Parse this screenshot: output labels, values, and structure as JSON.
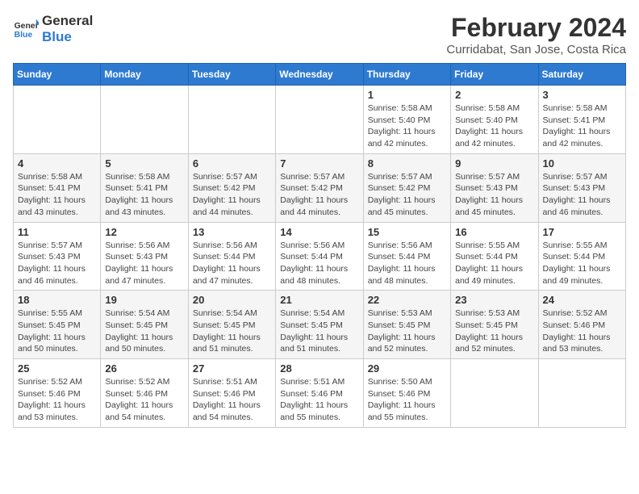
{
  "logo": {
    "line1": "General",
    "line2": "Blue"
  },
  "title": "February 2024",
  "location": "Curridabat, San Jose, Costa Rica",
  "weekdays": [
    "Sunday",
    "Monday",
    "Tuesday",
    "Wednesday",
    "Thursday",
    "Friday",
    "Saturday"
  ],
  "weeks": [
    [
      {
        "day": "",
        "info": ""
      },
      {
        "day": "",
        "info": ""
      },
      {
        "day": "",
        "info": ""
      },
      {
        "day": "",
        "info": ""
      },
      {
        "day": "1",
        "info": "Sunrise: 5:58 AM\nSunset: 5:40 PM\nDaylight: 11 hours\nand 42 minutes."
      },
      {
        "day": "2",
        "info": "Sunrise: 5:58 AM\nSunset: 5:40 PM\nDaylight: 11 hours\nand 42 minutes."
      },
      {
        "day": "3",
        "info": "Sunrise: 5:58 AM\nSunset: 5:41 PM\nDaylight: 11 hours\nand 42 minutes."
      }
    ],
    [
      {
        "day": "4",
        "info": "Sunrise: 5:58 AM\nSunset: 5:41 PM\nDaylight: 11 hours\nand 43 minutes."
      },
      {
        "day": "5",
        "info": "Sunrise: 5:58 AM\nSunset: 5:41 PM\nDaylight: 11 hours\nand 43 minutes."
      },
      {
        "day": "6",
        "info": "Sunrise: 5:57 AM\nSunset: 5:42 PM\nDaylight: 11 hours\nand 44 minutes."
      },
      {
        "day": "7",
        "info": "Sunrise: 5:57 AM\nSunset: 5:42 PM\nDaylight: 11 hours\nand 44 minutes."
      },
      {
        "day": "8",
        "info": "Sunrise: 5:57 AM\nSunset: 5:42 PM\nDaylight: 11 hours\nand 45 minutes."
      },
      {
        "day": "9",
        "info": "Sunrise: 5:57 AM\nSunset: 5:43 PM\nDaylight: 11 hours\nand 45 minutes."
      },
      {
        "day": "10",
        "info": "Sunrise: 5:57 AM\nSunset: 5:43 PM\nDaylight: 11 hours\nand 46 minutes."
      }
    ],
    [
      {
        "day": "11",
        "info": "Sunrise: 5:57 AM\nSunset: 5:43 PM\nDaylight: 11 hours\nand 46 minutes."
      },
      {
        "day": "12",
        "info": "Sunrise: 5:56 AM\nSunset: 5:43 PM\nDaylight: 11 hours\nand 47 minutes."
      },
      {
        "day": "13",
        "info": "Sunrise: 5:56 AM\nSunset: 5:44 PM\nDaylight: 11 hours\nand 47 minutes."
      },
      {
        "day": "14",
        "info": "Sunrise: 5:56 AM\nSunset: 5:44 PM\nDaylight: 11 hours\nand 48 minutes."
      },
      {
        "day": "15",
        "info": "Sunrise: 5:56 AM\nSunset: 5:44 PM\nDaylight: 11 hours\nand 48 minutes."
      },
      {
        "day": "16",
        "info": "Sunrise: 5:55 AM\nSunset: 5:44 PM\nDaylight: 11 hours\nand 49 minutes."
      },
      {
        "day": "17",
        "info": "Sunrise: 5:55 AM\nSunset: 5:44 PM\nDaylight: 11 hours\nand 49 minutes."
      }
    ],
    [
      {
        "day": "18",
        "info": "Sunrise: 5:55 AM\nSunset: 5:45 PM\nDaylight: 11 hours\nand 50 minutes."
      },
      {
        "day": "19",
        "info": "Sunrise: 5:54 AM\nSunset: 5:45 PM\nDaylight: 11 hours\nand 50 minutes."
      },
      {
        "day": "20",
        "info": "Sunrise: 5:54 AM\nSunset: 5:45 PM\nDaylight: 11 hours\nand 51 minutes."
      },
      {
        "day": "21",
        "info": "Sunrise: 5:54 AM\nSunset: 5:45 PM\nDaylight: 11 hours\nand 51 minutes."
      },
      {
        "day": "22",
        "info": "Sunrise: 5:53 AM\nSunset: 5:45 PM\nDaylight: 11 hours\nand 52 minutes."
      },
      {
        "day": "23",
        "info": "Sunrise: 5:53 AM\nSunset: 5:45 PM\nDaylight: 11 hours\nand 52 minutes."
      },
      {
        "day": "24",
        "info": "Sunrise: 5:52 AM\nSunset: 5:46 PM\nDaylight: 11 hours\nand 53 minutes."
      }
    ],
    [
      {
        "day": "25",
        "info": "Sunrise: 5:52 AM\nSunset: 5:46 PM\nDaylight: 11 hours\nand 53 minutes."
      },
      {
        "day": "26",
        "info": "Sunrise: 5:52 AM\nSunset: 5:46 PM\nDaylight: 11 hours\nand 54 minutes."
      },
      {
        "day": "27",
        "info": "Sunrise: 5:51 AM\nSunset: 5:46 PM\nDaylight: 11 hours\nand 54 minutes."
      },
      {
        "day": "28",
        "info": "Sunrise: 5:51 AM\nSunset: 5:46 PM\nDaylight: 11 hours\nand 55 minutes."
      },
      {
        "day": "29",
        "info": "Sunrise: 5:50 AM\nSunset: 5:46 PM\nDaylight: 11 hours\nand 55 minutes."
      },
      {
        "day": "",
        "info": ""
      },
      {
        "day": "",
        "info": ""
      }
    ]
  ]
}
